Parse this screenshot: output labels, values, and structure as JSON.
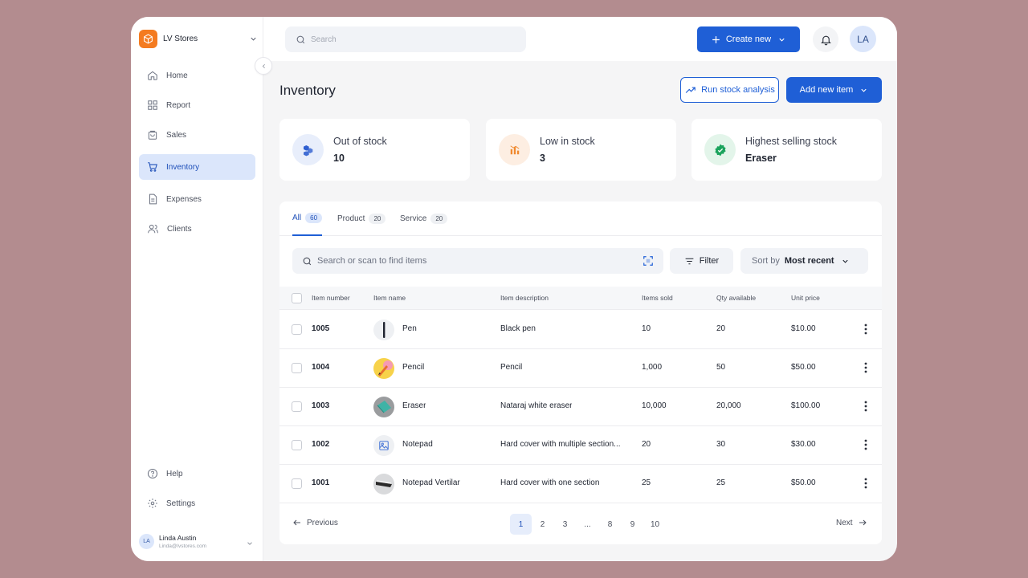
{
  "brand": {
    "name": "LV Stores",
    "icon": "cube-icon",
    "color": "#f47b20"
  },
  "sidebar": {
    "items": [
      {
        "label": "Home",
        "icon": "home-icon"
      },
      {
        "label": "Report",
        "icon": "grid-icon"
      },
      {
        "label": "Sales",
        "icon": "bag-icon"
      },
      {
        "label": "Inventory",
        "icon": "cart-icon",
        "active": true
      },
      {
        "label": "Expenses",
        "icon": "document-icon"
      },
      {
        "label": "Clients",
        "icon": "users-icon"
      }
    ],
    "bottom_items": [
      {
        "label": "Help",
        "icon": "help-icon"
      },
      {
        "label": "Settings",
        "icon": "gear-icon"
      }
    ],
    "user": {
      "initials": "LA",
      "name": "Linda Austin",
      "email": "Linda@lvstores.com"
    }
  },
  "header": {
    "search_placeholder": "Search",
    "create_label": "Create new",
    "avatar_initials": "LA"
  },
  "page": {
    "title": "Inventory",
    "run_analysis_label": "Run stock analysis",
    "add_item_label": "Add new item"
  },
  "stats": [
    {
      "label": "Out of stock",
      "value": "10",
      "icon": "boxes-icon",
      "color": "#2f5fd0",
      "bg": "#e8eefb"
    },
    {
      "label": "Low in stock",
      "value": "3",
      "icon": "bar-chart-icon",
      "color": "#f0892e",
      "bg": "#fdeee2"
    },
    {
      "label": "Highest selling stock",
      "value": "Eraser",
      "icon": "badge-icon",
      "color": "#1aa35c",
      "bg": "#e3f5ea"
    }
  ],
  "tabs": [
    {
      "label": "All",
      "count": "60",
      "active": true
    },
    {
      "label": "Product",
      "count": "20"
    },
    {
      "label": "Service",
      "count": "20"
    }
  ],
  "toolbar": {
    "find_placeholder": "Search or scan to find items",
    "filter_label": "Filter",
    "sort_prefix": "Sort by",
    "sort_value": "Most recent"
  },
  "table": {
    "columns": [
      "Item number",
      "Item name",
      "Item description",
      "Items sold",
      "Qty available",
      "Unit price"
    ],
    "rows": [
      {
        "number": "1005",
        "name": "Pen",
        "description": "Black pen",
        "sold": "10",
        "qty": "20",
        "price": "$10.00",
        "thumb": "pen"
      },
      {
        "number": "1004",
        "name": "Pencil",
        "description": "Pencil",
        "sold": "1,000",
        "qty": "50",
        "price": "$50.00",
        "thumb": "pencil"
      },
      {
        "number": "1003",
        "name": "Eraser",
        "description": "Nataraj white eraser",
        "sold": "10,000",
        "qty": "20,000",
        "price": "$100.00",
        "thumb": "eraser"
      },
      {
        "number": "1002",
        "name": "Notepad",
        "description": "Hard cover with multiple section...",
        "sold": "20",
        "qty": "30",
        "price": "$30.00",
        "thumb": "placeholder"
      },
      {
        "number": "1001",
        "name": "Notepad Vertilar",
        "description": "Hard cover with one section",
        "sold": "25",
        "qty": "25",
        "price": "$50.00",
        "thumb": "notepad"
      }
    ]
  },
  "pagination": {
    "previous_label": "Previous",
    "next_label": "Next",
    "pages": [
      "1",
      "2",
      "3",
      "...",
      "8",
      "9",
      "10"
    ],
    "current": "1"
  }
}
